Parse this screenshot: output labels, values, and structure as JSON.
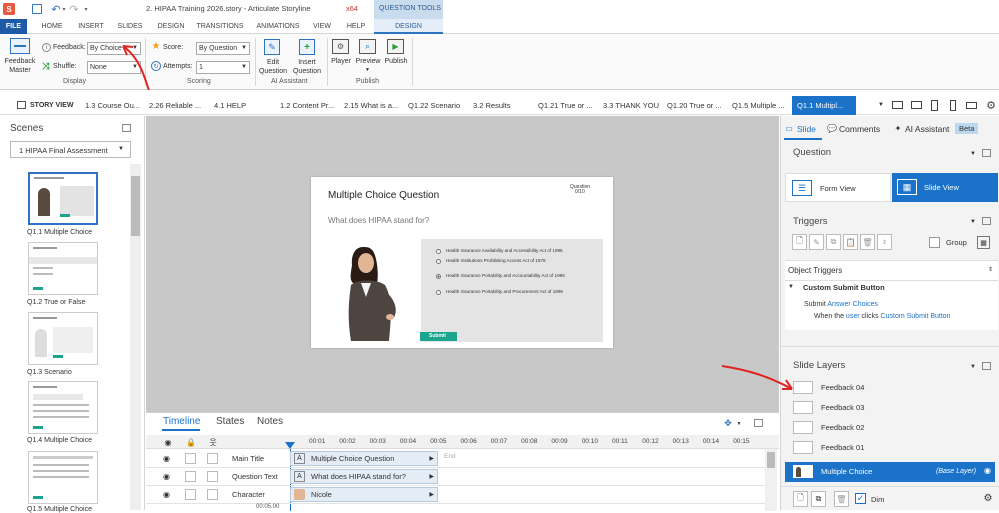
{
  "app": {
    "title": "2. HIPAA Training 2026.story - Articulate Storyline",
    "arch": "x64",
    "question_tools": "QUESTION TOOLS"
  },
  "tabs": [
    "FILE",
    "HOME",
    "INSERT",
    "SLIDES",
    "DESIGN",
    "TRANSITIONS",
    "ANIMATIONS",
    "VIEW",
    "HELP",
    "DESIGN"
  ],
  "ribbon": {
    "feedback_master": "Feedback Master",
    "feedback_label": "Feedback:",
    "feedback_value": "By Choice",
    "shuffle_label": "Shuffle:",
    "shuffle_value": "None",
    "display_group": "Display",
    "score_label": "Score:",
    "score_value": "By Question",
    "attempts_label": "Attempts:",
    "attempts_value": "1",
    "scoring_group": "Scoring",
    "edit_question": "Edit Question",
    "insert_question": "Insert Question",
    "ai_group": "AI Assistant",
    "player": "Player",
    "preview": "Preview",
    "publish": "Publish",
    "publish_group": "Publish"
  },
  "storybar": {
    "story_view": "STORY VIEW",
    "items": [
      "1.3 Course Ou...",
      "2.26 Reliable ...",
      "4.1 HELP",
      "1.2 Content Pr...",
      "2.15 What is a...",
      "Q1.22 Scenario",
      "3.2 Results",
      "Q1.21 True or ...",
      "3.3 THANK YOU",
      "Q1.20 True or ...",
      "Q1.5 Multiple ...",
      "Q1.1 Multipl..."
    ]
  },
  "scenes": {
    "title": "Scenes",
    "selected_scene": "1 HIPAA Final Assessment",
    "slides": [
      "Q1.1 Multiple Choice",
      "Q1.2 True or False",
      "Q1.3 Scenario",
      "Q1.4 Multiple Choice",
      "Q1.5 Multiple Choice"
    ]
  },
  "slide": {
    "title": "Multiple Choice Question",
    "question_counter": "Question",
    "question_of": "0/10",
    "prompt": "What does HIPAA stand for?",
    "choices": [
      "Health Insurance Availability and Accessibility Act of 1995",
      "Health Institutions Prohibiting Access Act of 1978",
      "Health Insurance Portability and Accountability Act of 1996",
      "Health Insurance Portability and Procurement Act of 1996"
    ],
    "submit": "Submit"
  },
  "timeline": {
    "tabs": [
      "Timeline",
      "States",
      "Notes"
    ],
    "ticks": [
      "00:01",
      "00:02",
      "00:03",
      "00:04",
      "00:05",
      "00:06",
      "00:07",
      "00:08",
      "00:09",
      "00:10",
      "00:11",
      "00:12",
      "00:13",
      "00:14",
      "00:15"
    ],
    "rows": [
      {
        "name": "Main Title",
        "bar": "Multiple Choice Question"
      },
      {
        "name": "Question Text",
        "bar": "What does HIPAA stand for?"
      },
      {
        "name": "Character",
        "bar": "Nicole"
      }
    ],
    "end_label": "End",
    "time": "00:05.00"
  },
  "right_panel": {
    "tabs": [
      "Slide",
      "Comments",
      "AI Assistant"
    ],
    "beta": "Beta",
    "question_header": "Question",
    "form_view": "Form View",
    "slide_view": "Slide View",
    "triggers_header": "Triggers",
    "group_label": "Group",
    "object_triggers": "Object Triggers",
    "custom_submit": "Custom Submit Button",
    "trigger_line1_a": "Submit ",
    "trigger_line1_b": "Answer Choices",
    "trigger_line2_a": "When the ",
    "trigger_line2_b": "user",
    "trigger_line2_c": " clicks ",
    "trigger_line2_d": "Custom Submit Button",
    "slide_layers": "Slide Layers",
    "layers": [
      "Feedback 04",
      "Feedback 03",
      "Feedback 02",
      "Feedback 01"
    ],
    "base_layer": "Multiple Choice",
    "base_tag": "(Base Layer)",
    "dim": "Dim"
  },
  "colors": {
    "accent": "#2e74c0",
    "file_tab": "#1e5aa8",
    "selected_blue": "#1a73c9",
    "submit_green": "#1aa58c",
    "annotation_red": "#e0241f"
  }
}
